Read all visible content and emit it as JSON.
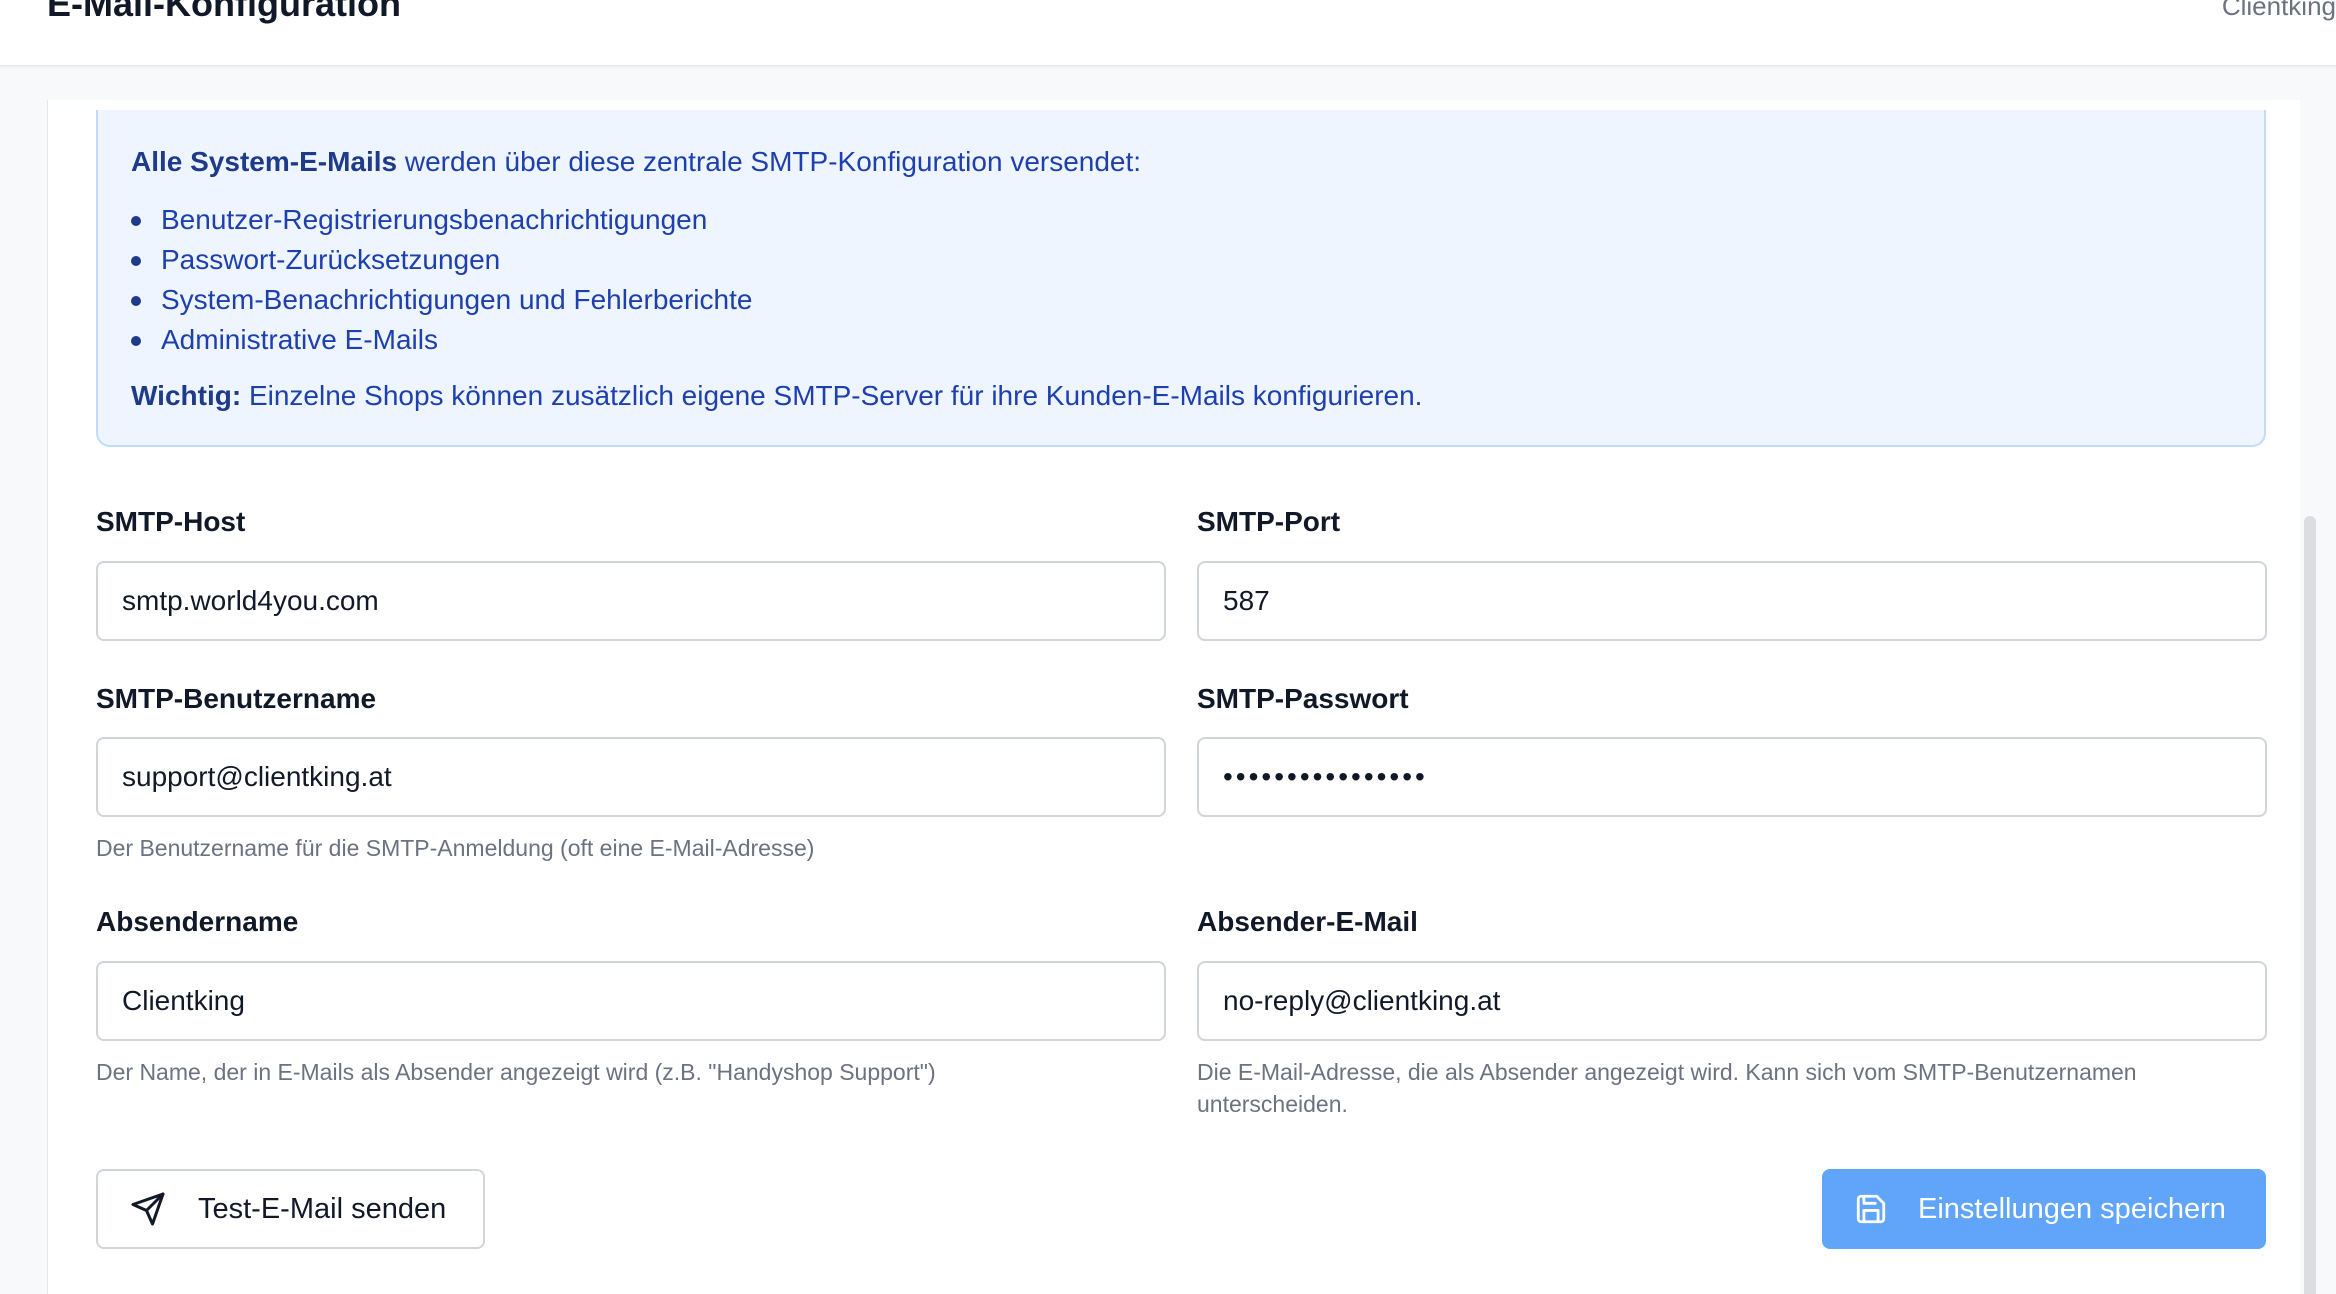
{
  "header": {
    "title": "E-Mail-Konfiguration",
    "org_name": "Clientking"
  },
  "info_box": {
    "lead_bold": "Alle System-E-Mails",
    "lead_rest": " werden über diese zentrale SMTP-Konfiguration versendet:",
    "items": [
      "Benutzer-Registrierungsbenachrichtigungen",
      "Passwort-Zurücksetzungen",
      "System-Benachrichtigungen und Fehlerberichte",
      "Administrative E-Mails"
    ],
    "note_bold": "Wichtig:",
    "note_rest": " Einzelne Shops können zusätzlich eigene SMTP-Server für ihre Kunden-E-Mails konfigurieren."
  },
  "form": {
    "smtp_host": {
      "label": "SMTP-Host",
      "value": "smtp.world4you.com"
    },
    "smtp_port": {
      "label": "SMTP-Port",
      "value": "587"
    },
    "smtp_user": {
      "label": "SMTP-Benutzername",
      "value": "support@clientking.at",
      "help": "Der Benutzername für die SMTP-Anmeldung (oft eine E-Mail-Adresse)"
    },
    "smtp_password": {
      "label": "SMTP-Passwort",
      "value": "••••••••••••••••"
    },
    "sender_name": {
      "label": "Absendername",
      "value": "Clientking",
      "help": "Der Name, der in E-Mails als Absender angezeigt wird (z.B. \"Handyshop Support\")"
    },
    "sender_email": {
      "label": "Absender-E-Mail",
      "value": "no-reply@clientking.at",
      "help": "Die E-Mail-Adresse, die als Absender angezeigt wird. Kann sich vom SMTP-Benutzernamen unterscheiden."
    }
  },
  "actions": {
    "test_label": "Test-E-Mail senden",
    "test_icon": "send-icon",
    "save_label": "Einstellungen speichern",
    "save_icon": "save-icon"
  },
  "colors": {
    "info_bg": "#eef5fe",
    "info_text": "#1e40af",
    "primary": "#60a5fa"
  }
}
